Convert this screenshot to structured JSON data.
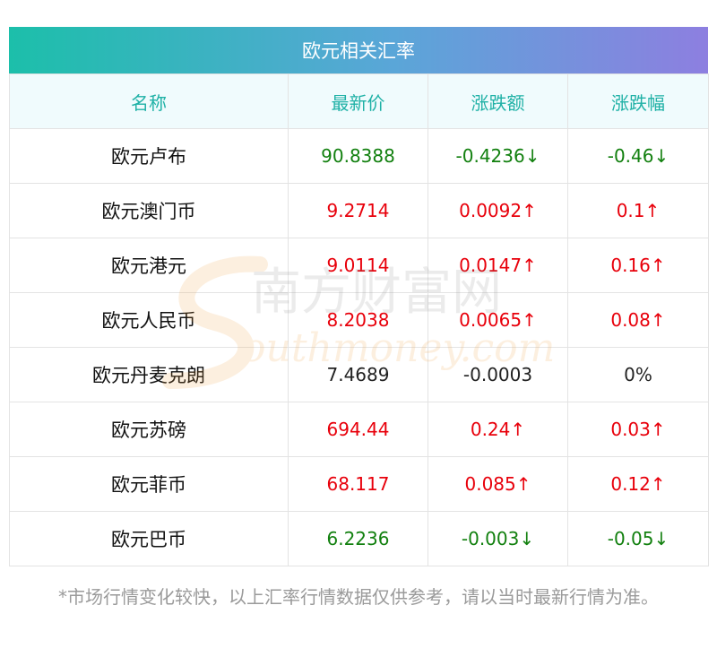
{
  "title": "欧元相关汇率",
  "headers": [
    "名称",
    "最新价",
    "涨跌额",
    "涨跌幅"
  ],
  "rows": [
    {
      "name": "欧元卢布",
      "price": "90.8388",
      "change": "-0.4236↓",
      "pct": "-0.46↓",
      "dir": "down"
    },
    {
      "name": "欧元澳门币",
      "price": "9.2714",
      "change": "0.0092↑",
      "pct": "0.1↑",
      "dir": "up"
    },
    {
      "name": "欧元港元",
      "price": "9.0114",
      "change": "0.0147↑",
      "pct": "0.16↑",
      "dir": "up"
    },
    {
      "name": "欧元人民币",
      "price": "8.2038",
      "change": "0.0065↑",
      "pct": "0.08↑",
      "dir": "up"
    },
    {
      "name": "欧元丹麦克朗",
      "price": "7.4689",
      "change": "-0.0003",
      "pct": "0%",
      "dir": "flat"
    },
    {
      "name": "欧元苏磅",
      "price": "694.44",
      "change": "0.24↑",
      "pct": "0.03↑",
      "dir": "up"
    },
    {
      "name": "欧元菲币",
      "price": "68.117",
      "change": "0.085↑",
      "pct": "0.12↑",
      "dir": "up"
    },
    {
      "name": "欧元巴币",
      "price": "6.2236",
      "change": "-0.003↓",
      "pct": "-0.05↓",
      "dir": "down"
    }
  ],
  "watermark": {
    "cn": "南方财富网",
    "en": "outhmoney.com"
  },
  "footnote": "*市场行情变化较快，以上汇率行情数据仅供参考，请以当时最新行情为准。",
  "colors": {
    "up": "#e8000b",
    "down": "#12800f",
    "header_text": "#1fb1a6"
  }
}
